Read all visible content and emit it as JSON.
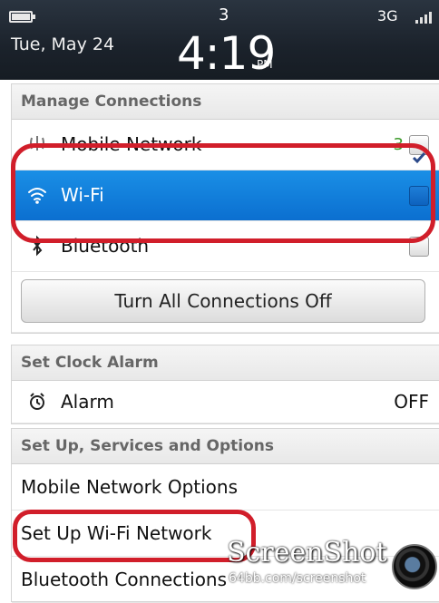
{
  "status_bar": {
    "notification_count": "3",
    "date": "Tue, May 24",
    "time": "4:19",
    "ampm": "PM",
    "network": "3G"
  },
  "manage_connections": {
    "header": "Manage Connections",
    "mobile_network": {
      "label": "Mobile Network",
      "indicator": "3",
      "checked": true
    },
    "wifi": {
      "label": "Wi-Fi",
      "checked": false,
      "selected": true
    },
    "bluetooth": {
      "label": "Bluetooth",
      "checked": false
    },
    "turn_off_button": "Turn All Connections Off"
  },
  "set_clock_alarm": {
    "header": "Set Clock Alarm",
    "alarm": {
      "label": "Alarm",
      "value": "OFF"
    }
  },
  "setup_services": {
    "header": "Set Up, Services and Options",
    "items": [
      "Mobile Network Options",
      "Set Up Wi-Fi Network",
      "Bluetooth Connections"
    ]
  },
  "watermark": {
    "title": "ScreenShot",
    "site": "64bb.com/screenshot"
  },
  "colors": {
    "selection_blue": "#0b6fd0",
    "annotation_red": "#d11e2a",
    "status_bar": "#1b222b"
  }
}
